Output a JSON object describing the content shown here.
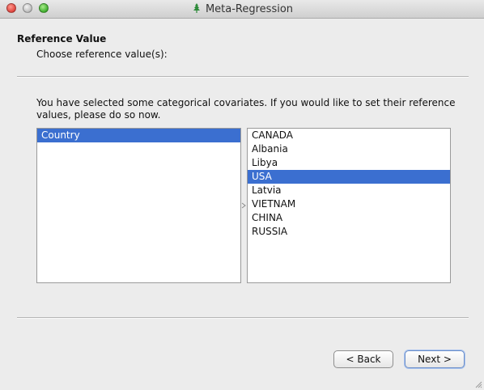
{
  "window": {
    "title": "Meta-Regression"
  },
  "header": {
    "title": "Reference Value",
    "subtitle": "Choose reference value(s):"
  },
  "instructions": "You have selected some categorical covariates. If you would like to set their reference values, please do so now.",
  "covariates_list": {
    "items": [
      {
        "label": "Country",
        "selected": true
      }
    ]
  },
  "values_list": {
    "items": [
      {
        "label": "CANADA",
        "selected": false
      },
      {
        "label": "Albania",
        "selected": false
      },
      {
        "label": "Libya",
        "selected": false
      },
      {
        "label": "USA",
        "selected": true
      },
      {
        "label": "Latvia",
        "selected": false
      },
      {
        "label": "VIETNAM",
        "selected": false
      },
      {
        "label": "CHINA",
        "selected": false
      },
      {
        "label": "RUSSIA",
        "selected": false
      }
    ]
  },
  "buttons": {
    "back_label": "< Back",
    "next_label": "Next >"
  },
  "colors": {
    "selection": "#3b6fd0",
    "close": "#e0443e",
    "minimize": "#bdbdbd",
    "zoom": "#3fae2e",
    "app_icon": "#2e8b3a"
  },
  "icons": {
    "app": "tree-icon",
    "splitter": "splitter-handle-icon",
    "resize": "resize-grip-icon"
  }
}
